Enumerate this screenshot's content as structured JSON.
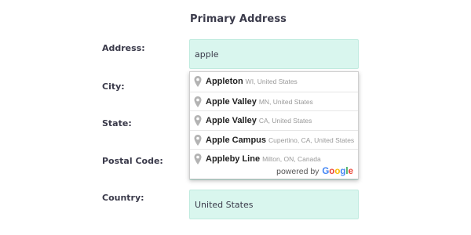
{
  "section_title": "Primary Address",
  "fields": {
    "address": {
      "label": "Address:",
      "value": "apple"
    },
    "city": {
      "label": "City:",
      "value": ""
    },
    "state": {
      "label": "State:",
      "value": ""
    },
    "postal_code": {
      "label": "Postal Code:",
      "value": ""
    },
    "country": {
      "label": "Country:",
      "value": "United States"
    }
  },
  "autocomplete": {
    "suggestions": [
      {
        "match": "Apple",
        "rest": "ton",
        "secondary": "WI, United States"
      },
      {
        "match": "Apple",
        "rest": " Valley",
        "secondary": "MN, United States"
      },
      {
        "match": "Apple",
        "rest": " Valley",
        "secondary": "CA, United States"
      },
      {
        "match": "Apple",
        "rest": " Campus",
        "secondary": "Cupertino, CA, United States"
      },
      {
        "match": "Apple",
        "rest": "by Line",
        "secondary": "Milton, ON, Canada"
      }
    ],
    "powered_by": "powered by",
    "logo": [
      "G",
      "o",
      "o",
      "g",
      "l",
      "e"
    ]
  },
  "colors": {
    "input_bg": "#d9f6ee",
    "label_text": "#3a3a4a"
  },
  "icons": {
    "suggestion_marker": "map-pin-icon"
  }
}
